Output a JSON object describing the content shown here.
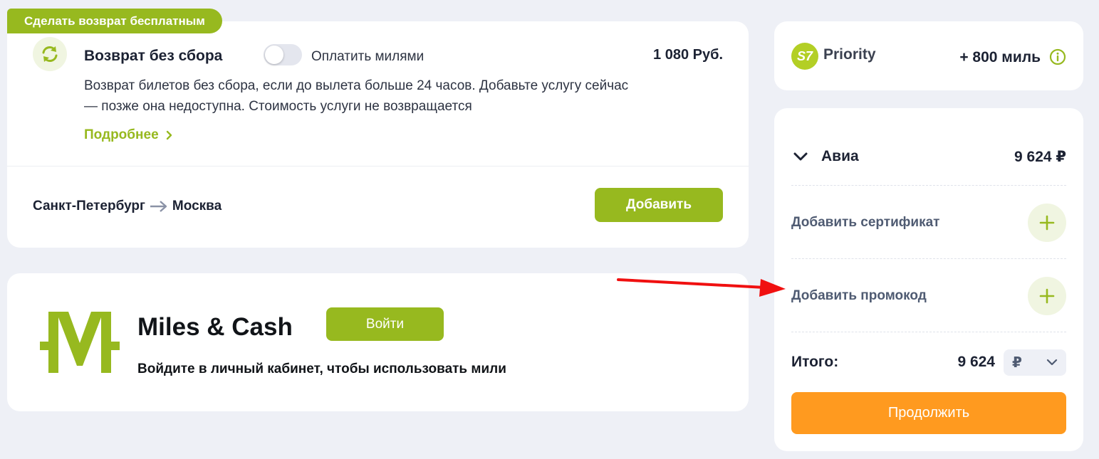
{
  "refund": {
    "promo_tag": "Сделать возврат бесплатным",
    "title": "Возврат без сбора",
    "toggle_label": "Оплатить милями",
    "toggle_on": false,
    "price": "1 080 Руб.",
    "description": "Возврат билетов без сбора, если до вылета больше 24 часов. Добавьте услугу сейчас — позже она недоступна. Стоимость услуги не возвращается",
    "more_link": "Подробнее",
    "route_from": "Санкт-Петербург",
    "route_to": "Москва",
    "add_button": "Добавить"
  },
  "miles_cash": {
    "title": "Miles & Cash",
    "login_button": "Войти",
    "subtitle": "Войдите в личный кабинет, чтобы использовать мили"
  },
  "priority": {
    "logo_text": "S7",
    "label": "Priority",
    "bonus": "+ 800 миль"
  },
  "order": {
    "avia_label": "Авиа",
    "avia_price": "9 624 ₽",
    "certificate_label": "Добавить сертификат",
    "promo_label": "Добавить промокод",
    "total_label": "Итого:",
    "total_value": "9 624",
    "currency": "₽",
    "continue_button": "Продолжить"
  },
  "icons": {
    "refund": "refresh-icon",
    "more_link": "chevron-right-icon",
    "route": "arrow-right-icon",
    "miles_logo": "miles-cash-logo",
    "info": "info-icon",
    "avia": "chevron-down-icon",
    "add": "plus-icon",
    "currency": "chevron-down-icon",
    "annotation": "red-arrow-icon"
  },
  "colors": {
    "accent_green": "#97b91f",
    "accent_orange": "#ff9a1f",
    "annotation_red": "#ff0000",
    "page_background": "#eef0f6"
  }
}
